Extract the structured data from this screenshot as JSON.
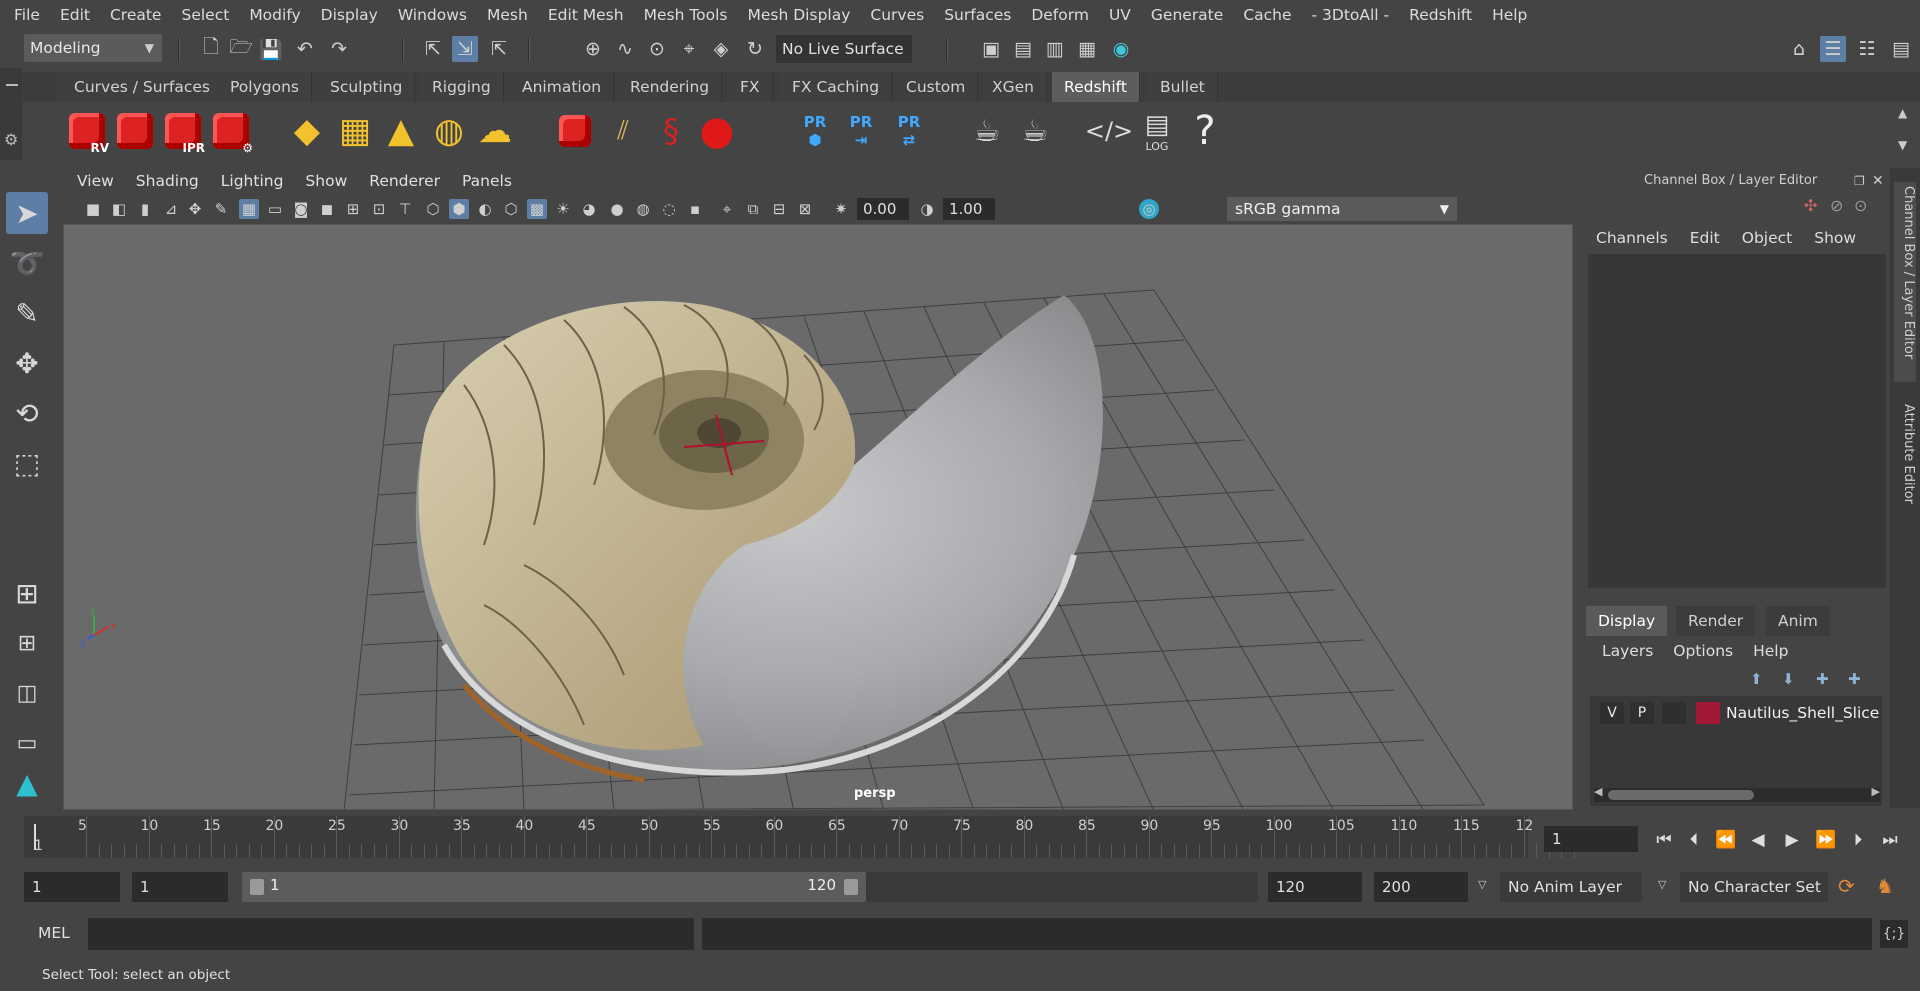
{
  "menubar": {
    "items": [
      "File",
      "Edit",
      "Create",
      "Select",
      "Modify",
      "Display",
      "Windows",
      "Mesh",
      "Edit Mesh",
      "Mesh Tools",
      "Mesh Display",
      "Curves",
      "Surfaces",
      "Deform",
      "UV",
      "Generate",
      "Cache",
      "- 3DtoAll -",
      "Redshift",
      "Help"
    ]
  },
  "statusline": {
    "mode": "Modeling",
    "live_surface": "No Live Surface"
  },
  "shelf": {
    "tabs": [
      "Curves / Surfaces",
      "Polygons",
      "Sculpting",
      "Rigging",
      "Animation",
      "Rendering",
      "FX",
      "FX Caching",
      "Custom",
      "XGen",
      "Redshift",
      "Bullet"
    ],
    "active_tab": "Redshift",
    "icons": {
      "rv": "RV",
      "ipr": "IPR",
      "pr": "PR",
      "log": "LOG",
      "help": "?"
    }
  },
  "viewport": {
    "menu": [
      "View",
      "Shading",
      "Lighting",
      "Show",
      "Renderer",
      "Panels"
    ],
    "exposure": "0.00",
    "gamma": "1.00",
    "color_space": "sRGB gamma",
    "camera": "persp",
    "axis": {
      "y": "y",
      "x": "x",
      "z": "z"
    }
  },
  "channelbox": {
    "title": "Channel Box / Layer Editor",
    "menu": [
      "Channels",
      "Edit",
      "Object",
      "Show"
    ]
  },
  "layereditor": {
    "tabs": [
      "Display",
      "Render",
      "Anim"
    ],
    "active_tab": "Display",
    "menu": [
      "Layers",
      "Options",
      "Help"
    ],
    "layers": [
      {
        "v": "V",
        "p": "P",
        "name": "Nautilus_Shell_Slice",
        "color": "#a01836"
      }
    ]
  },
  "sidetabs": [
    "Channel Box / Layer Editor",
    "Attribute Editor"
  ],
  "timeline": {
    "start_marker": "1",
    "labels": [
      "5",
      "10",
      "15",
      "20",
      "25",
      "30",
      "35",
      "40",
      "45",
      "50",
      "55",
      "60",
      "65",
      "70",
      "75",
      "80",
      "85",
      "90",
      "95",
      "100",
      "105",
      "110",
      "115",
      "12"
    ],
    "current_frame": "1"
  },
  "rangebar": {
    "start": "1",
    "playback_start": "1",
    "slider_start": "1",
    "slider_end": "120",
    "playback_end": "120",
    "end": "200",
    "anim_layer": "No Anim Layer",
    "character_set": "No Character Set"
  },
  "commandline": {
    "label": "MEL"
  },
  "helpline": {
    "text": "Select Tool: select an object"
  }
}
